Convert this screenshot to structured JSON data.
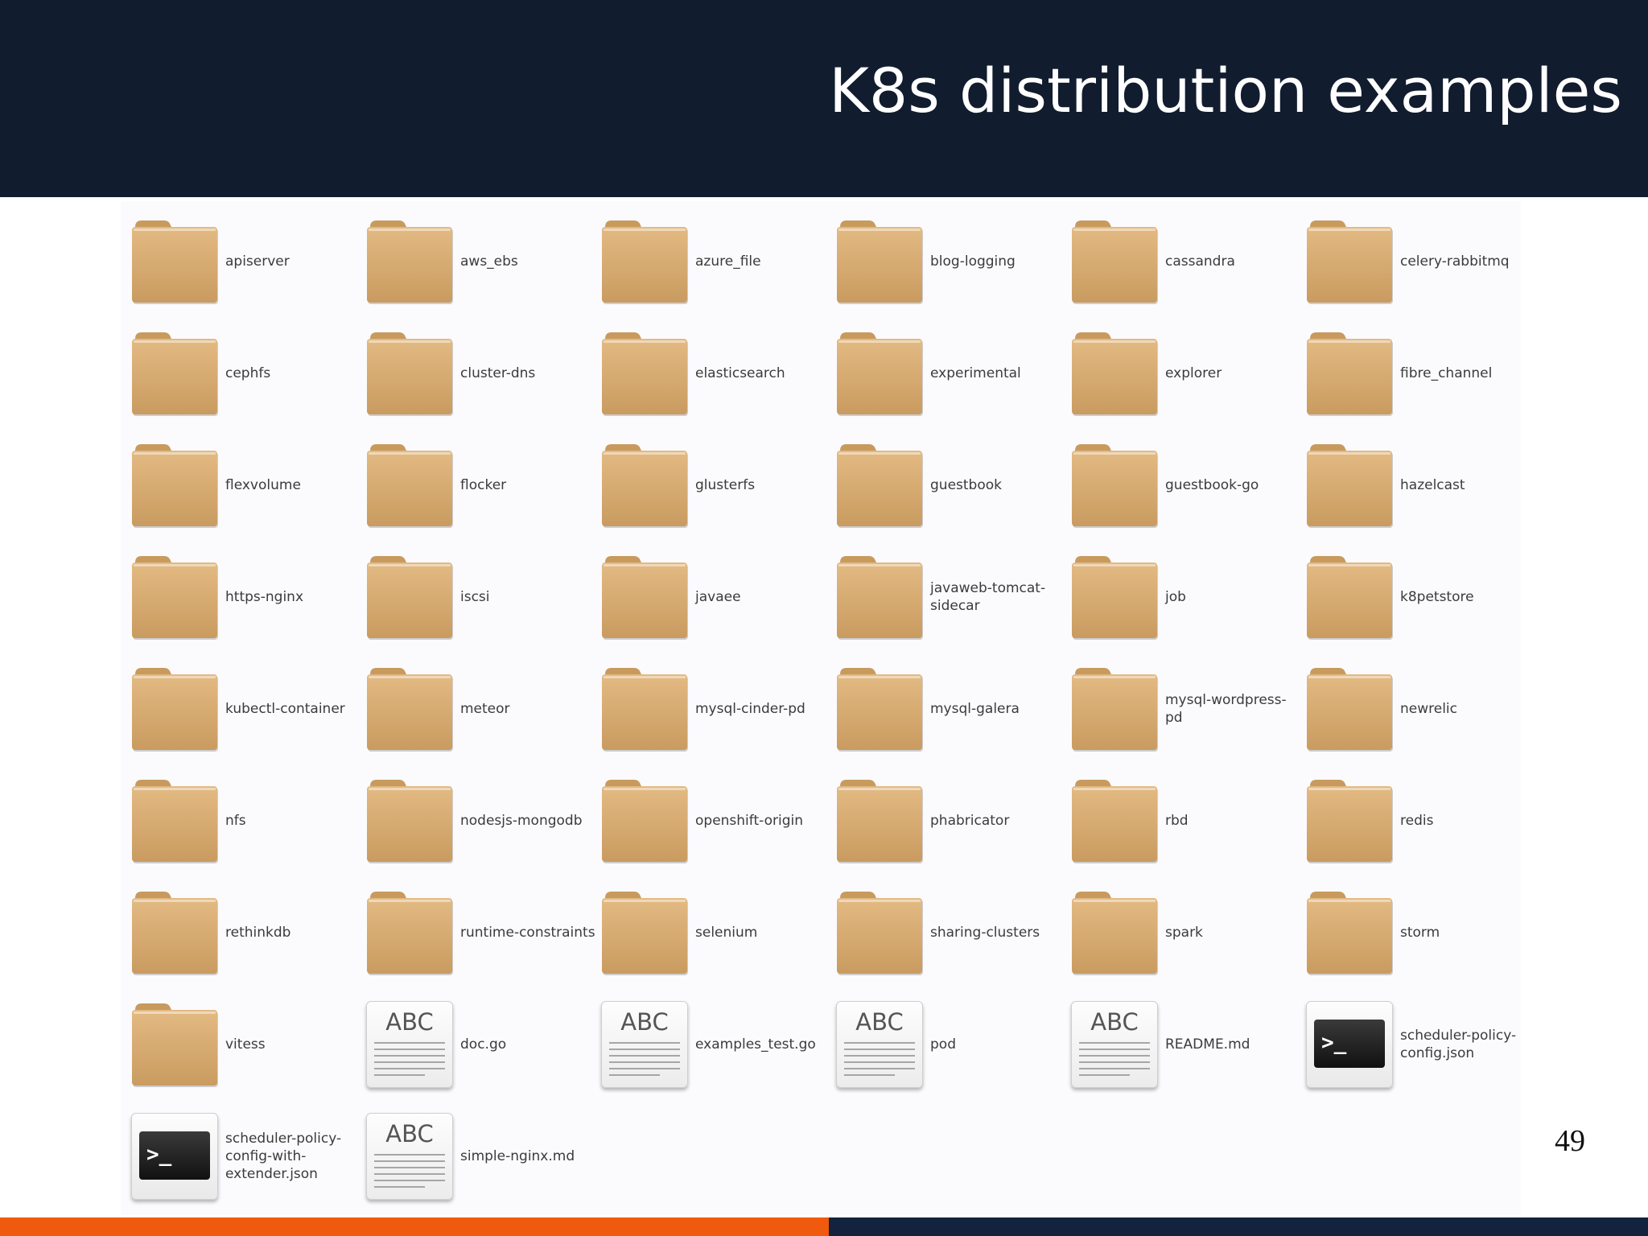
{
  "slide": {
    "title": "K8s distribution examples",
    "page_number": "49"
  },
  "colors": {
    "header_background": "#111c2f",
    "folder": "#d9ae74",
    "footer_orange": "#f05a0e",
    "footer_navy": "#13233e"
  },
  "files": [
    {
      "label": "apiserver",
      "type": "folder"
    },
    {
      "label": "aws_ebs",
      "type": "folder"
    },
    {
      "label": "azure_file",
      "type": "folder"
    },
    {
      "label": "blog-logging",
      "type": "folder"
    },
    {
      "label": "cassandra",
      "type": "folder"
    },
    {
      "label": "celery-rabbitmq",
      "type": "folder"
    },
    {
      "label": "cephfs",
      "type": "folder"
    },
    {
      "label": "cluster-dns",
      "type": "folder"
    },
    {
      "label": "elasticsearch",
      "type": "folder"
    },
    {
      "label": "experimental",
      "type": "folder"
    },
    {
      "label": "explorer",
      "type": "folder"
    },
    {
      "label": "fibre_channel",
      "type": "folder"
    },
    {
      "label": "flexvolume",
      "type": "folder"
    },
    {
      "label": "flocker",
      "type": "folder"
    },
    {
      "label": "glusterfs",
      "type": "folder"
    },
    {
      "label": "guestbook",
      "type": "folder"
    },
    {
      "label": "guestbook-go",
      "type": "folder"
    },
    {
      "label": "hazelcast",
      "type": "folder"
    },
    {
      "label": "https-nginx",
      "type": "folder"
    },
    {
      "label": "iscsi",
      "type": "folder"
    },
    {
      "label": "javaee",
      "type": "folder"
    },
    {
      "label": "javaweb-tomcat-sidecar",
      "type": "folder"
    },
    {
      "label": "job",
      "type": "folder"
    },
    {
      "label": "k8petstore",
      "type": "folder"
    },
    {
      "label": "kubectl-container",
      "type": "folder"
    },
    {
      "label": "meteor",
      "type": "folder"
    },
    {
      "label": "mysql-cinder-pd",
      "type": "folder"
    },
    {
      "label": "mysql-galera",
      "type": "folder"
    },
    {
      "label": "mysql-wordpress-pd",
      "type": "folder"
    },
    {
      "label": "newrelic",
      "type": "folder"
    },
    {
      "label": "nfs",
      "type": "folder"
    },
    {
      "label": "nodesjs-mongodb",
      "type": "folder"
    },
    {
      "label": "openshift-origin",
      "type": "folder"
    },
    {
      "label": "phabricator",
      "type": "folder"
    },
    {
      "label": "rbd",
      "type": "folder"
    },
    {
      "label": "redis",
      "type": "folder"
    },
    {
      "label": "rethinkdb",
      "type": "folder"
    },
    {
      "label": "runtime-constraints",
      "type": "folder"
    },
    {
      "label": "selenium",
      "type": "folder"
    },
    {
      "label": "sharing-clusters",
      "type": "folder"
    },
    {
      "label": "spark",
      "type": "folder"
    },
    {
      "label": "storm",
      "type": "folder"
    },
    {
      "label": "vitess",
      "type": "folder"
    },
    {
      "label": "doc.go",
      "type": "document"
    },
    {
      "label": "examples_test.go",
      "type": "document"
    },
    {
      "label": "pod",
      "type": "document"
    },
    {
      "label": "README.md",
      "type": "document"
    },
    {
      "label": "scheduler-policy-config.json",
      "type": "terminal"
    },
    {
      "label": "scheduler-policy-config-with-extender.json",
      "type": "terminal"
    },
    {
      "label": "simple-nginx.md",
      "type": "document"
    }
  ],
  "icons": {
    "folder": "folder-icon",
    "document": "text-document-icon",
    "terminal": "terminal-script-icon"
  },
  "document_icon_text": "ABC",
  "terminal_icon_text": ">_"
}
